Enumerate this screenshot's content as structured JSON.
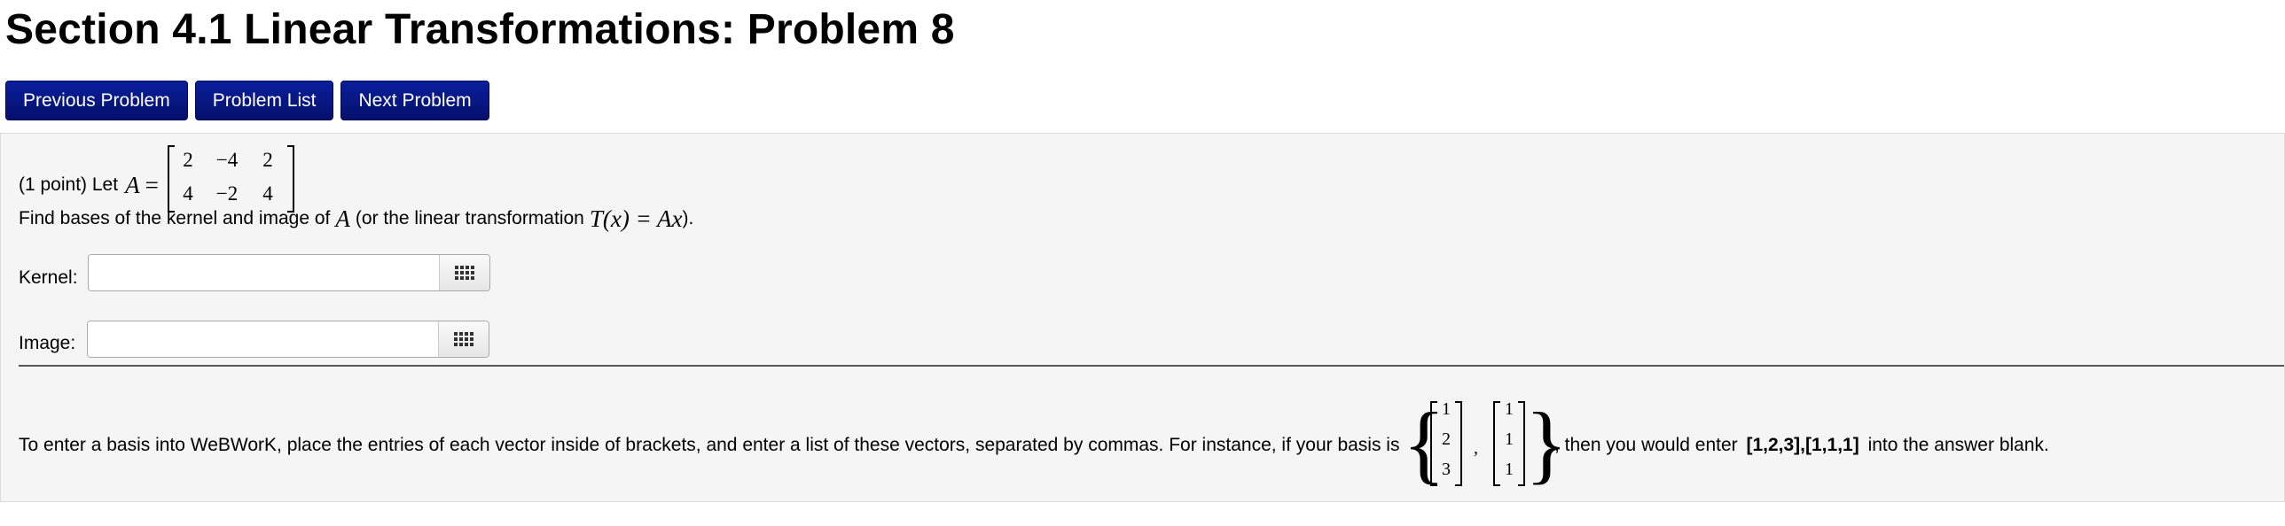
{
  "header": {
    "title": "Section 4.1 Linear Transformations: Problem 8"
  },
  "nav": {
    "previous_label": "Previous Problem",
    "list_label": "Problem List",
    "next_label": "Next Problem"
  },
  "problem": {
    "points_prefix": "(1 point) Let",
    "matrix_name": "A",
    "equals": "=",
    "matrix": [
      [
        "2",
        "−4",
        "2"
      ],
      [
        "4",
        "−2",
        "4"
      ]
    ],
    "instruction_before": "Find bases of the kernel and image of",
    "instruction_var": "A",
    "instruction_middle": "(or the linear transformation",
    "instruction_formula": "T(x) = Ax",
    "instruction_end": ").",
    "kernel_label": "Kernel:",
    "kernel_value": "",
    "image_label": "Image:",
    "image_value": "",
    "hint_before": "To enter a basis into WeBWorK, place the entries of each vector inside of brackets, and enter a list of these vectors, separated by commas. For instance, if your basis is",
    "hint_vectors": [
      [
        "1",
        "2",
        "3"
      ],
      [
        "1",
        "1",
        "1"
      ]
    ],
    "hint_comma": ",",
    "hint_middle": ", then you would enter",
    "hint_example": "[1,2,3],[1,1,1]",
    "hint_after": "into the answer blank."
  },
  "icons": {
    "keyboard": "keyboard-grid-icon"
  }
}
